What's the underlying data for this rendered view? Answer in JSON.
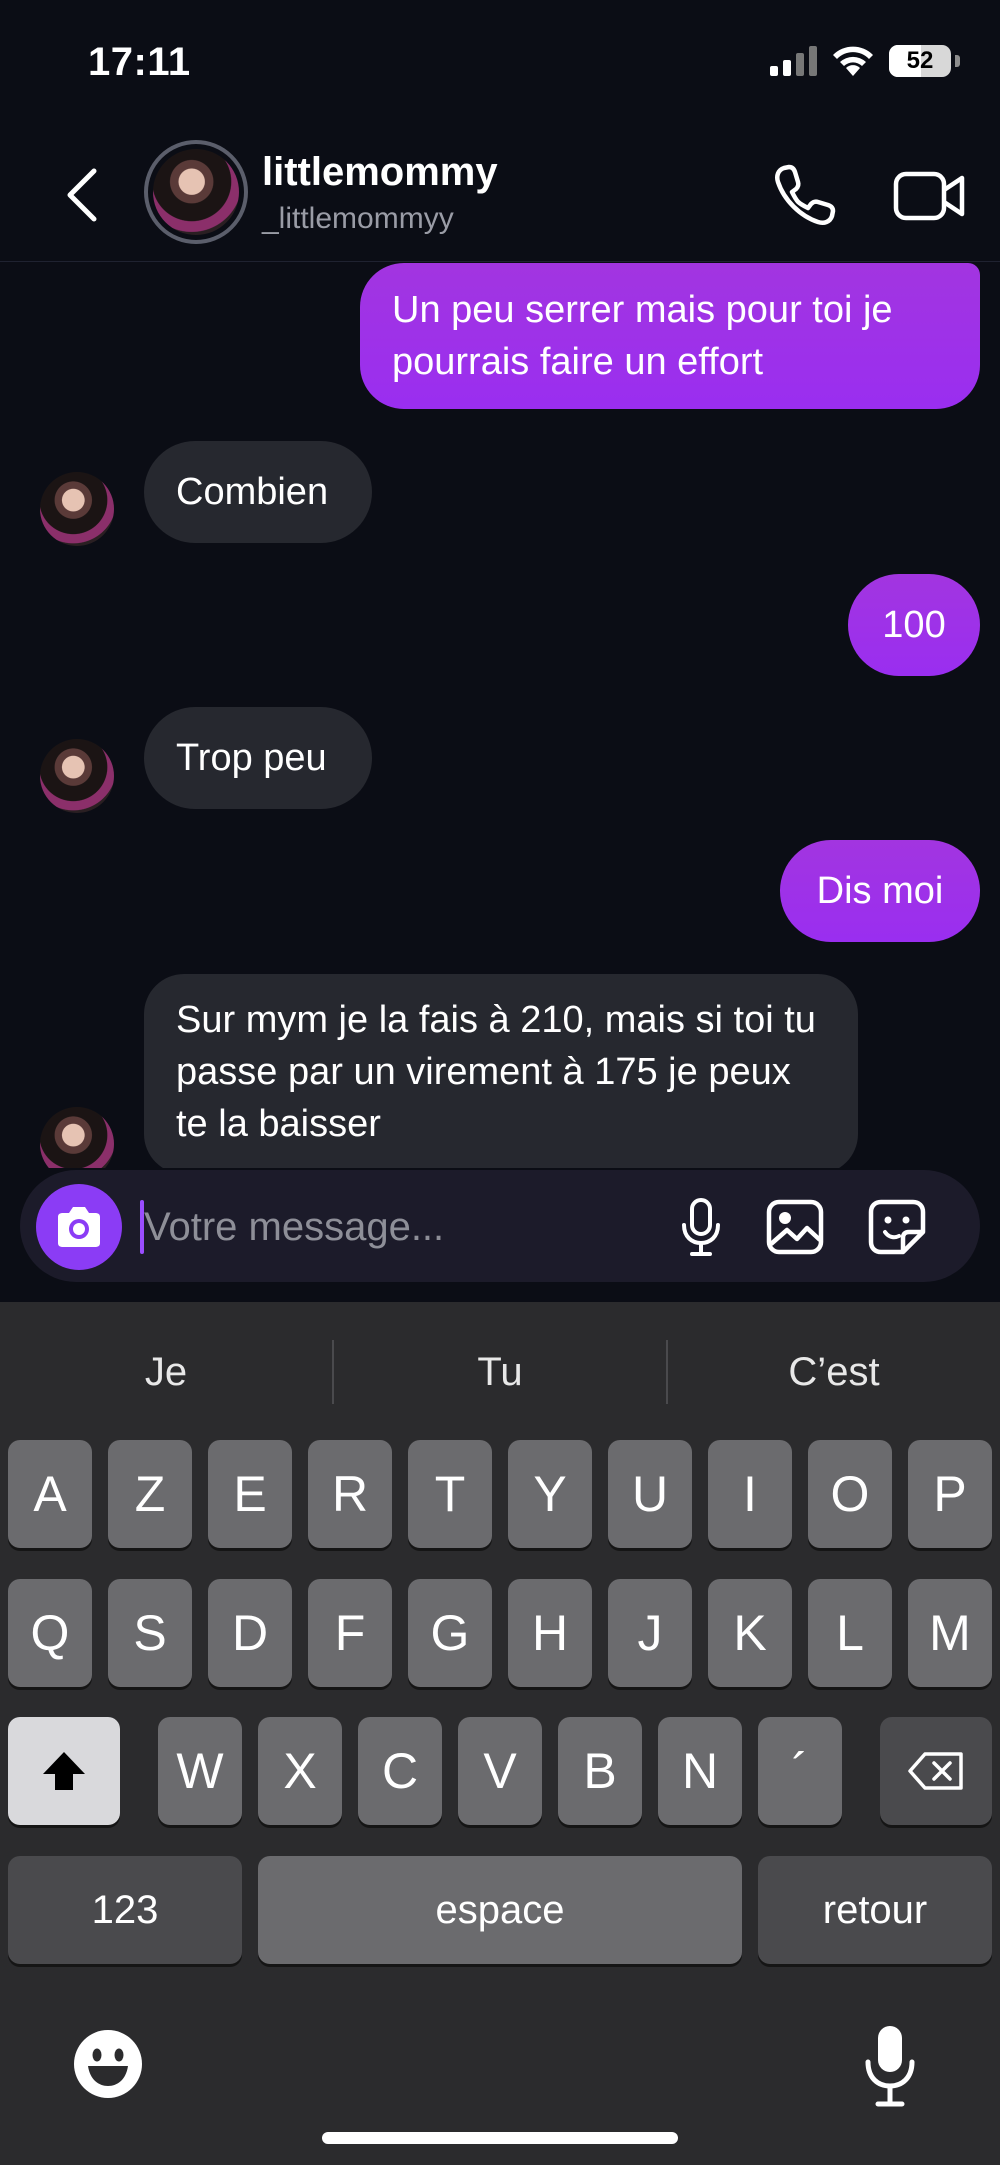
{
  "status": {
    "time": "17:11",
    "battery": "52"
  },
  "header": {
    "name": "littlemommy",
    "handle": "_littlemommyy",
    "icons": [
      "chevron-left-icon",
      "phone-icon",
      "video-camera-icon"
    ]
  },
  "messages": [
    {
      "direction": "out",
      "text": "Un peu serrer mais pour toi je pourrais faire un effort"
    },
    {
      "direction": "in",
      "text": "Combien"
    },
    {
      "direction": "out",
      "text": "100"
    },
    {
      "direction": "in",
      "text": "Trop peu"
    },
    {
      "direction": "out",
      "text": "Dis moi"
    },
    {
      "direction": "in",
      "text": "Sur mym je la fais à 210, mais si toi tu passe par un virement à 175 je peux te la baisser"
    }
  ],
  "composer": {
    "placeholder": "Votre message...",
    "icons": [
      "camera-icon",
      "microphone-icon",
      "image-icon",
      "sticker-icon"
    ]
  },
  "keyboard": {
    "suggestions": [
      "Je",
      "Tu",
      "C’est"
    ],
    "row1": [
      "A",
      "Z",
      "E",
      "R",
      "T",
      "Y",
      "U",
      "I",
      "O",
      "P"
    ],
    "row2": [
      "Q",
      "S",
      "D",
      "F",
      "G",
      "H",
      "J",
      "K",
      "L",
      "M"
    ],
    "row3": [
      "W",
      "X",
      "C",
      "V",
      "B",
      "N",
      "´"
    ],
    "numbers_label": "123",
    "space_label": "espace",
    "return_label": "retour"
  },
  "colors": {
    "background": "#0b0d15",
    "outgoing_bubble": "#9a2ef0",
    "incoming_bubble": "#26282f",
    "accent": "#8b3cf5"
  }
}
